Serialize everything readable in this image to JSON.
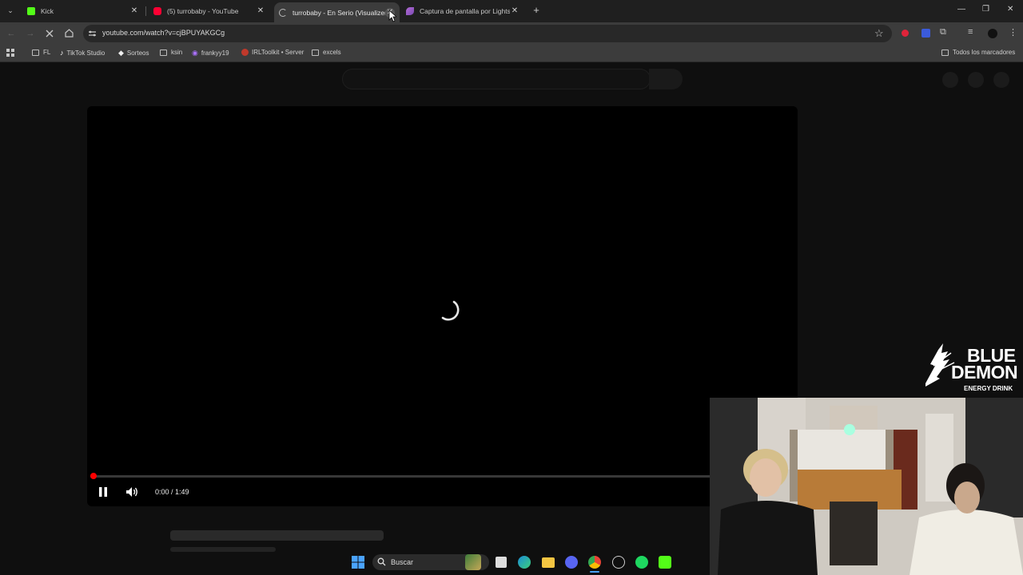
{
  "browser": {
    "tabs": [
      {
        "title": "Kick",
        "favicon": "kick-icon",
        "color": "#53fc18",
        "active": false
      },
      {
        "title": "(5) turrobaby - YouTube",
        "favicon": "youtube-icon",
        "color": "#ff0033",
        "active": false
      },
      {
        "title": "turrobaby - En Serio (Visualizer)",
        "favicon": "loading-icon",
        "color": "#bdbdbd",
        "active": true
      },
      {
        "title": "Captura de pantalla por Lightshot",
        "favicon": "lightshot-feather-icon",
        "color": "#9b59b6",
        "active": false
      }
    ],
    "url": "youtube.com/watch?v=cjBPUYAKGCg",
    "bookmarks": [
      {
        "label": "FL",
        "icon": "folder-icon"
      },
      {
        "label": "TikTok Studio",
        "icon": "tiktok-icon"
      },
      {
        "label": "Sorteos",
        "icon": "diamond-icon"
      },
      {
        "label": "ksin",
        "icon": "folder-icon"
      },
      {
        "label": "frankyy19",
        "icon": "twitch-icon"
      },
      {
        "label": "IRLToolkit • Server",
        "icon": "irltoolkit-icon"
      },
      {
        "label": "excels",
        "icon": "folder-icon"
      }
    ],
    "all_bookmarks_label": "Todos los marcadores"
  },
  "player": {
    "time": "0:00 / 1:49",
    "progress": 0,
    "accent": "#ff0000",
    "state": "loading"
  },
  "overlay": {
    "brand_line1": "BLUE",
    "brand_line2": "DEMON",
    "brand_line3": "ENERGY DRINK"
  },
  "taskbar": {
    "search_label": "Buscar",
    "apps": [
      "windows-start-icon",
      "search-icon",
      "game-icon",
      "task-view-icon",
      "edge-icon",
      "file-explorer-icon",
      "discord-icon",
      "chrome-icon",
      "app-icon",
      "spotify-icon",
      "kick-icon"
    ]
  }
}
